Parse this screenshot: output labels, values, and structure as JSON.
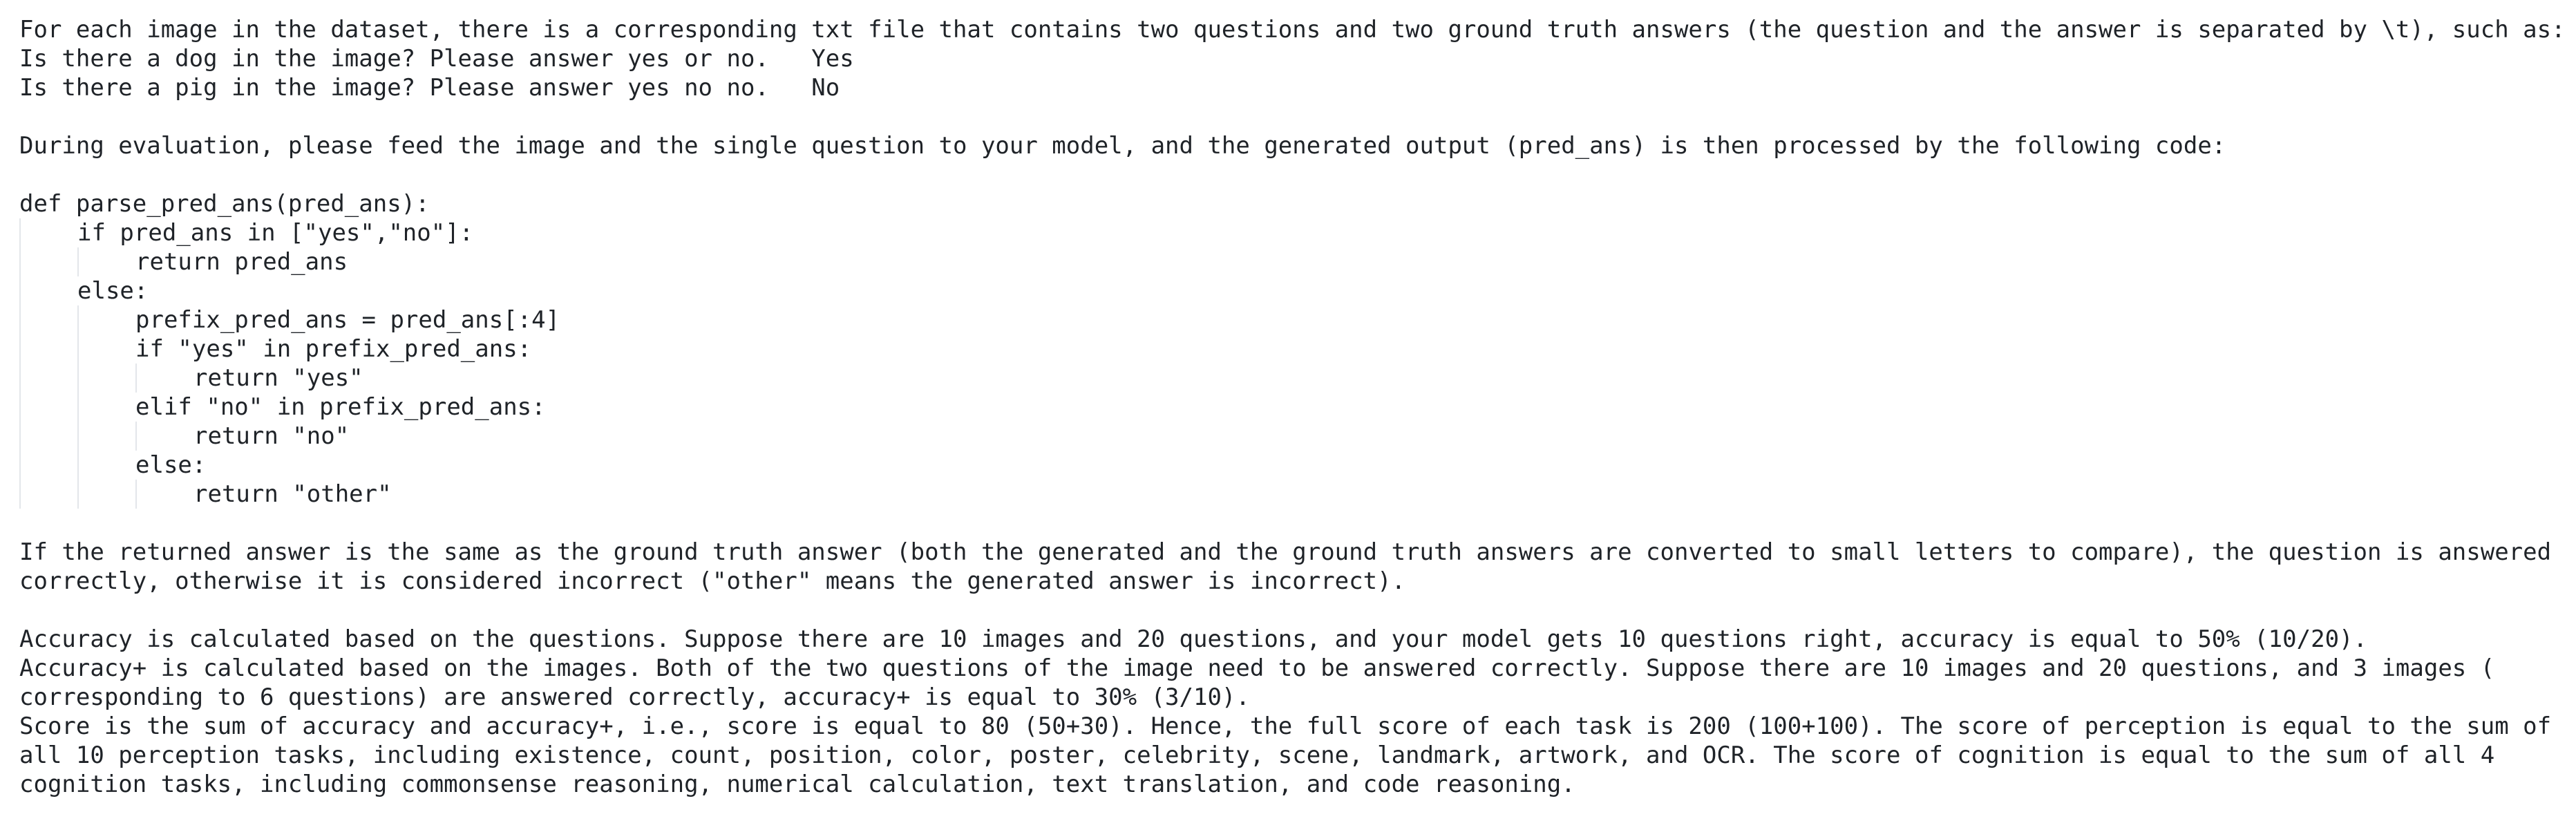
{
  "intro": {
    "line1": "For each image in the dataset, there is a corresponding txt file that contains two questions and two ground truth answers (the question and the answer is separated by \\t), such as:",
    "example1": "Is there a dog in the image? Please answer yes or no.   Yes",
    "example2": "Is there a pig in the image? Please answer yes no no.   No"
  },
  "evaluation": {
    "line": "During evaluation, please feed the image and the single question to your model, and the generated output (pred_ans) is then processed by the following code:"
  },
  "code": [
    "def parse_pred_ans(pred_ans):",
    "if pred_ans in [\"yes\",\"no\"]:",
    "return pred_ans",
    "else:",
    "prefix_pred_ans = pred_ans[:4]",
    "if \"yes\" in prefix_pred_ans:",
    "return \"yes\"",
    "elif \"no\" in prefix_pred_ans:",
    "return \"no\"",
    "else:",
    "return \"other\""
  ],
  "comparison": {
    "line1": "If the returned answer is the same as the ground truth answer (both the generated and the ground truth answers are converted to small letters to compare), the question is answered",
    "line2": "correctly, otherwise it is considered incorrect (\"other\" means the generated answer is incorrect)."
  },
  "metrics": {
    "accuracy": "Accuracy is calculated based on the questions. Suppose there are 10 images and 20 questions, and your model gets 10 questions right, accuracy is equal to 50% (10/20).",
    "accuracy_plus_1": "Accuracy+ is calculated based on the images. Both of the two questions of the image need to be answered correctly. Suppose there are 10 images and 20 questions, and 3 images (",
    "accuracy_plus_2": "corresponding to 6 questions) are answered correctly, accuracy+ is equal to 30% (3/10).",
    "score_1": "Score is the sum of accuracy and accuracy+, i.e., score is equal to 80 (50+30). Hence, the full score of each task is 200 (100+100). The score of perception is equal to the sum of",
    "score_2": "all 10 perception tasks, including existence, count, position, color, poster, celebrity, scene, landmark, artwork, and OCR. The score of cognition is equal to the sum of all 4",
    "score_3": "cognition tasks, including commonsense reasoning, numerical calculation, text translation, and code reasoning."
  }
}
